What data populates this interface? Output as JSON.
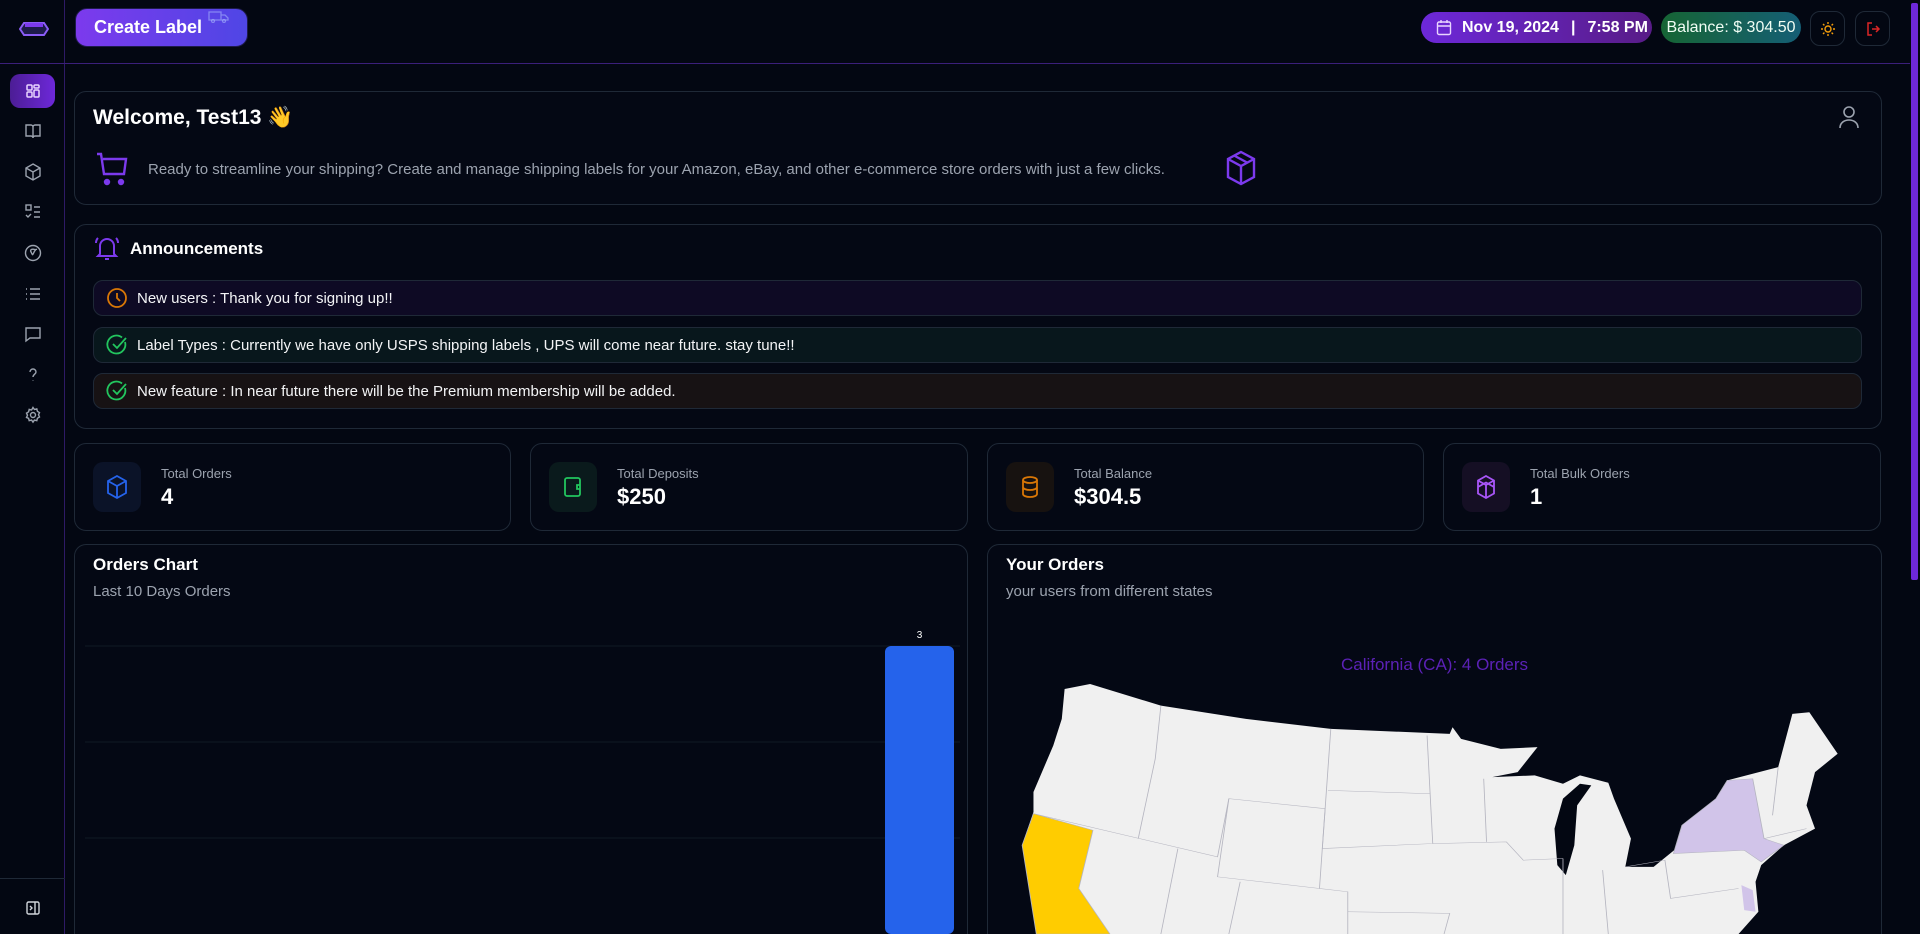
{
  "header": {
    "create_label": "Create Label",
    "date": "Nov 19, 2024",
    "separator": "|",
    "time": "7:58 PM",
    "balance": "Balance: $ 304.50"
  },
  "sidebar": {
    "items": [
      {
        "icon": "dashboard-icon",
        "active": true
      },
      {
        "icon": "book-icon"
      },
      {
        "icon": "package-icon"
      },
      {
        "icon": "checklist-icon"
      },
      {
        "icon": "dollar-icon"
      },
      {
        "icon": "list-icon"
      },
      {
        "icon": "message-icon"
      },
      {
        "icon": "help-icon"
      },
      {
        "icon": "settings-icon"
      }
    ]
  },
  "welcome": {
    "title": "Welcome, Test13",
    "emoji": "👋",
    "text": "Ready to streamline your shipping? Create and manage shipping labels for your Amazon, eBay, and other e-commerce store orders with just a few clicks."
  },
  "announcements": {
    "title": "Announcements",
    "items": [
      {
        "text": "New users : Thank you for signing up!!",
        "icon": "clock-icon",
        "color": "#d97706"
      },
      {
        "text": "Label Types : Currently we have only USPS shipping labels , UPS will come near future. stay tune!!",
        "icon": "check-circle-icon",
        "color": "#22c55e"
      },
      {
        "text": "New feature : In near future there will be the Premium membership will be added.",
        "icon": "check-circle-icon",
        "color": "#22c55e"
      }
    ]
  },
  "stats": [
    {
      "label": "Total Orders",
      "value": "4",
      "color": "#2563eb"
    },
    {
      "label": "Total Deposits",
      "value": "$250",
      "color": "#22c55e"
    },
    {
      "label": "Total Balance",
      "value": "$304.5",
      "color": "#d97706"
    },
    {
      "label": "Total Bulk Orders",
      "value": "1",
      "color": "#a855f7"
    }
  ],
  "orders_chart": {
    "title": "Orders Chart",
    "subtitle": "Last 10 Days Orders"
  },
  "chart_data": {
    "type": "bar",
    "values": [
      0,
      0,
      0,
      0,
      0,
      0,
      0,
      0,
      0,
      3
    ],
    "data_labels": [
      "",
      "",
      "",
      "",
      "",
      "",
      "",
      "",
      "",
      "3"
    ],
    "ylim": [
      0,
      3
    ],
    "grid": true,
    "color": "#2563eb"
  },
  "your_orders": {
    "title": "Your Orders",
    "subtitle": "your users from different states",
    "tooltip": "California (CA): 4 Orders",
    "highlight_color": "#ffcc00",
    "secondary_color": "#d1c4e9"
  }
}
